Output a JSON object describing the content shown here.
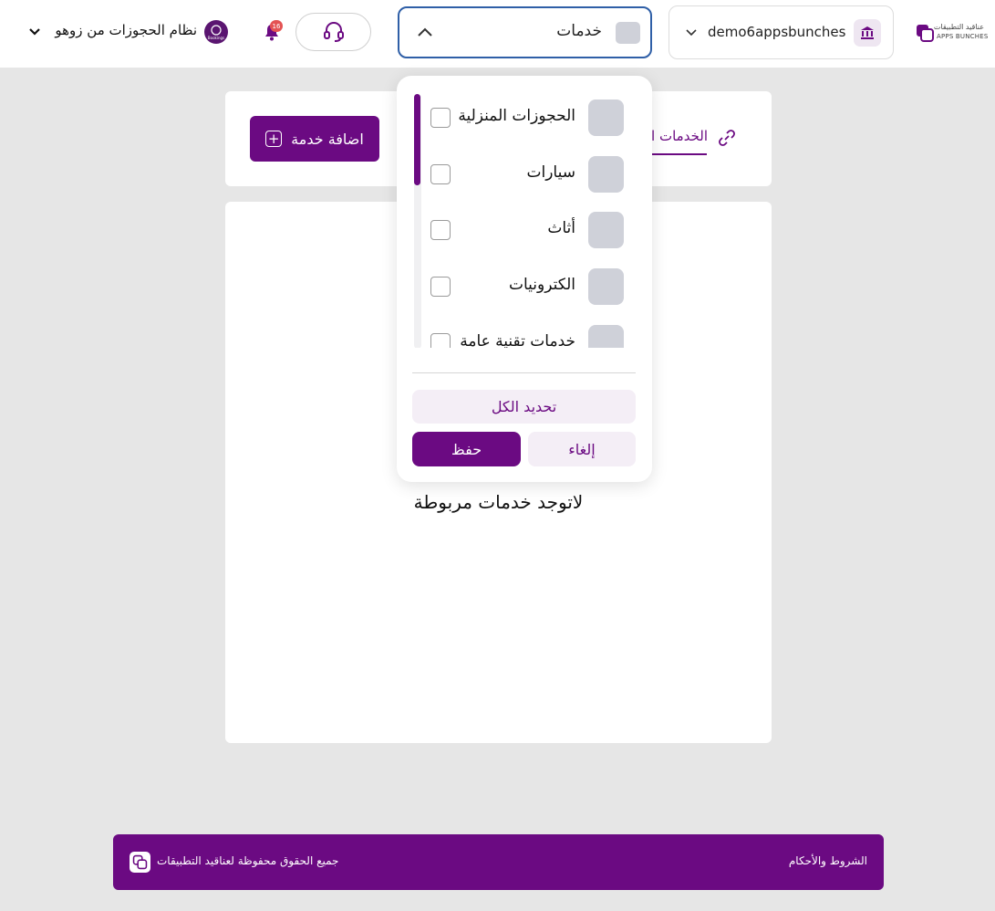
{
  "header": {
    "logo_ar": "عناقيد التطبيقات",
    "logo_en": "APPS BUNCHES",
    "account_name": "demo6appsbunches",
    "category_selected": "خدمات",
    "notifications_count": "16",
    "app_avatar_text": "Bookings",
    "app_name": "نظام الحجوزات من زوهو"
  },
  "toolbar": {
    "tab_label": "الخدمات المربوطة",
    "add_button": "اضافة خدمة"
  },
  "main": {
    "empty_message": "لاتوجد خدمات مربوطة"
  },
  "dropdown": {
    "options": [
      {
        "label": "الحجوزات المنزلية",
        "checked": false
      },
      {
        "label": "سيارات",
        "checked": false
      },
      {
        "label": "أثاث",
        "checked": false
      },
      {
        "label": "الكترونيات",
        "checked": false
      },
      {
        "label": "خدمات تقنية عامة",
        "checked": false
      }
    ],
    "select_all": "تحديد الكل",
    "save": "حفظ",
    "cancel": "إلغاء"
  },
  "footer": {
    "copyright": "جميع الحقوق محفوظة لعناقيد التطبيقات",
    "terms": "الشروط والأحكام"
  },
  "colors": {
    "brand": "#6b0a82",
    "focus_border": "#2f5fa7",
    "badge": "#e45353"
  }
}
